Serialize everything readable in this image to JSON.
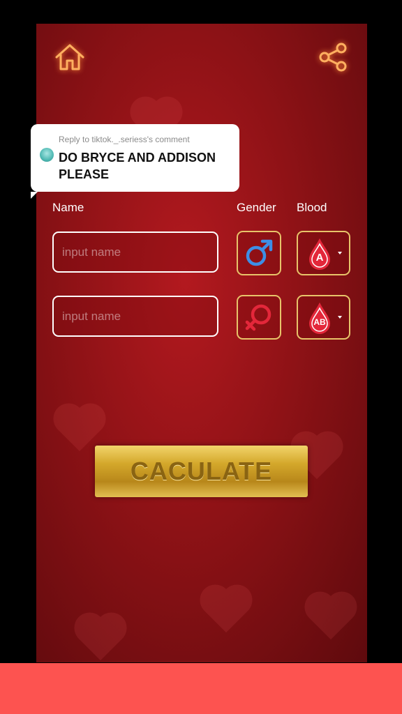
{
  "comment": {
    "reply_to": "Reply to tiktok._.seriess's comment",
    "message": "DO BRYCE AND ADDISON PLEASE"
  },
  "form": {
    "name_label": "Name",
    "gender_label": "Gender",
    "blood_label": "Blood",
    "rows": [
      {
        "name_placeholder": "input name",
        "gender": "male",
        "blood_type": "A"
      },
      {
        "name_placeholder": "input name",
        "gender": "female",
        "blood_type": "AB"
      }
    ]
  },
  "calculate_button": {
    "label": "CACULATE"
  },
  "icons": {
    "home": "home-icon",
    "share": "share-icon",
    "male": "male-symbol-icon",
    "female": "female-symbol-icon",
    "blood": "blood-drop-icon"
  },
  "colors": {
    "background_red": "#8e1216",
    "gold_border": "#e8c46a",
    "male_blue": "#3d8ee6",
    "female_red": "#e3273a",
    "bottom_bar": "#fd5350"
  }
}
